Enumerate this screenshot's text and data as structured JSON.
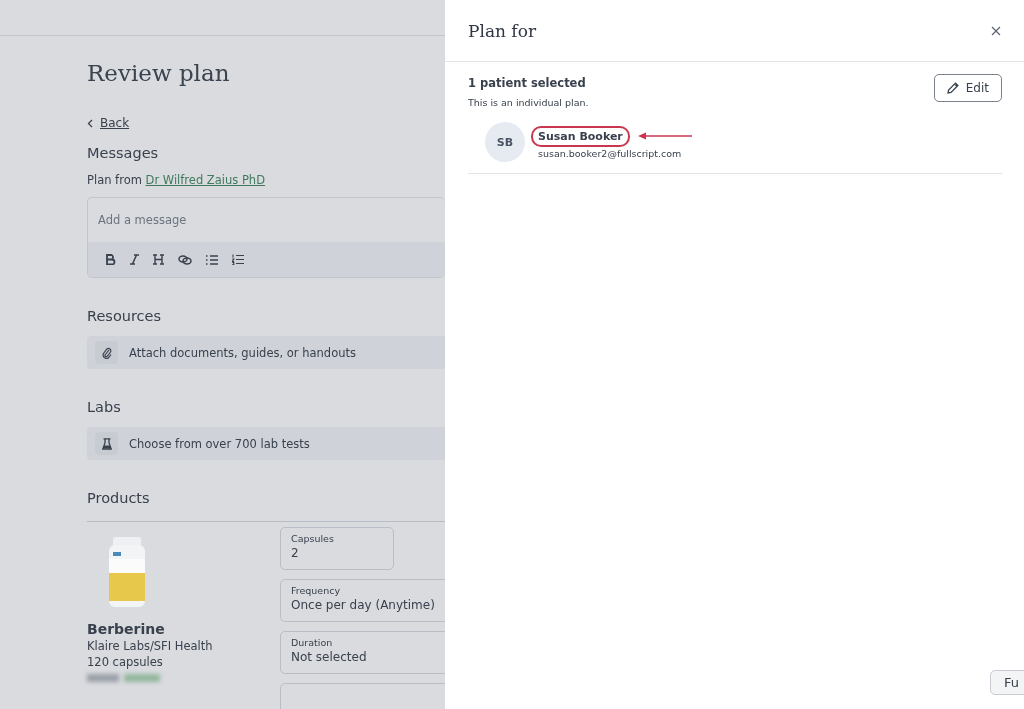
{
  "page": {
    "title": "Review plan",
    "back_link": "Back",
    "messages": {
      "heading": "Messages",
      "from_label": "Plan from",
      "from_link": "Dr Wilfred Zaius PhD",
      "placeholder": "Add a message"
    },
    "resources": {
      "heading": "Resources",
      "action": "Attach documents, guides, or handouts"
    },
    "labs": {
      "heading": "Labs",
      "action": "Choose from over 700 lab tests"
    },
    "products": {
      "heading": "Products",
      "items": [
        {
          "name": "Berberine",
          "brand": "Klaire Labs/SFI Health",
          "size": "120 capsules",
          "fields": [
            {
              "label": "Capsules",
              "value": "2"
            },
            {
              "label": "Frequency",
              "value": "Once per day (Anytime)"
            },
            {
              "label": "Duration",
              "value": "Not selected"
            }
          ]
        }
      ]
    }
  },
  "drawer": {
    "title": "Plan for",
    "summary": "1 patient selected",
    "description": "This is an individual plan.",
    "edit_button": "Edit",
    "patients": [
      {
        "initials": "SB",
        "name": "Susan Booker",
        "email": "susan.booker2@fullscript.com",
        "highlighted": true
      }
    ]
  },
  "floating_button": "Fu"
}
